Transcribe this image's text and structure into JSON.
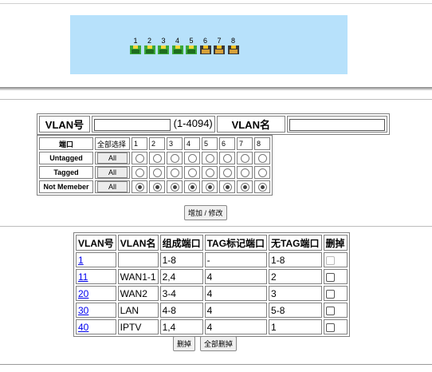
{
  "switch": {
    "ports": [
      {
        "num": "1",
        "status": "up"
      },
      {
        "num": "2",
        "status": "up"
      },
      {
        "num": "3",
        "status": "up"
      },
      {
        "num": "4",
        "status": "up"
      },
      {
        "num": "5",
        "status": "up"
      },
      {
        "num": "6",
        "status": "down"
      },
      {
        "num": "7",
        "status": "down"
      },
      {
        "num": "8",
        "status": "down"
      }
    ]
  },
  "form": {
    "vlan_id_label": "VLAN号",
    "vlan_id_value": "",
    "vlan_range": "(1-4094)",
    "vlan_name_label": "VLAN名",
    "vlan_name_value": ""
  },
  "port_config": {
    "port_header": "端口",
    "select_all_header": "全部选择",
    "ports": [
      "1",
      "2",
      "3",
      "4",
      "5",
      "6",
      "7",
      "8"
    ],
    "rows": [
      {
        "label": "Untagged",
        "all": "All",
        "selected": [
          false,
          false,
          false,
          false,
          false,
          false,
          false,
          false
        ]
      },
      {
        "label": "Tagged",
        "all": "All",
        "selected": [
          false,
          false,
          false,
          false,
          false,
          false,
          false,
          false
        ]
      },
      {
        "label": "Not Memeber",
        "all": "All",
        "selected": [
          true,
          true,
          true,
          true,
          true,
          true,
          true,
          true
        ]
      }
    ]
  },
  "add_button": "增加 / 修改",
  "vlan_table": {
    "headers": [
      "VLAN号",
      "VLAN名",
      "组成端口",
      "TAG标记端口",
      "无TAG端口",
      "删掉"
    ],
    "rows": [
      {
        "id": "1",
        "name": "",
        "ports": "1-8",
        "tag": "-",
        "untag": "1-8",
        "deletable": false
      },
      {
        "id": "11",
        "name": "WAN1-1",
        "ports": "2,4",
        "tag": "4",
        "untag": "2",
        "deletable": true
      },
      {
        "id": "20",
        "name": "WAN2",
        "ports": "3-4",
        "tag": "4",
        "untag": "3",
        "deletable": true
      },
      {
        "id": "30",
        "name": "LAN",
        "ports": "4-8",
        "tag": "4",
        "untag": "5-8",
        "deletable": true
      },
      {
        "id": "40",
        "name": "IPTV",
        "ports": "1,4",
        "tag": "4",
        "untag": "1",
        "deletable": true
      }
    ]
  },
  "delete_button": "删掉",
  "delete_all_button": "全部删掉"
}
